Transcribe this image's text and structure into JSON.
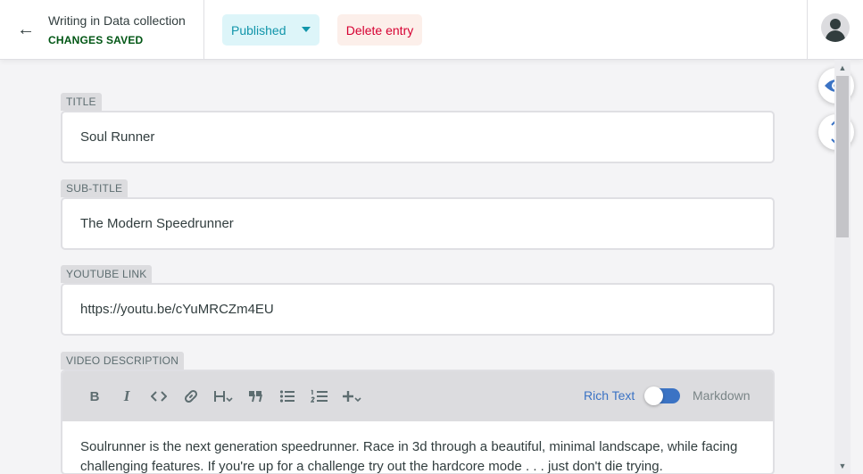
{
  "header": {
    "back_icon": "arrow-left-icon",
    "collection_label": "Writing in Data collection",
    "save_status": "CHANGES SAVED",
    "status_dropdown": {
      "selected": "Published"
    },
    "delete_label": "Delete entry",
    "avatar_icon": "user-avatar-icon"
  },
  "fields": {
    "title": {
      "label": "TITLE",
      "value": "Soul Runner"
    },
    "subtitle": {
      "label": "SUB-TITLE",
      "value": "The Modern Speedrunner"
    },
    "youtube": {
      "label": "YOUTUBE LINK",
      "value": "https://youtu.be/cYuMRCZm4EU"
    },
    "description": {
      "label": "VIDEO DESCRIPTION",
      "toolbar": [
        "bold-icon",
        "italic-icon",
        "code-icon",
        "link-icon",
        "heading-icon",
        "quote-icon",
        "bulleted-list-icon",
        "numbered-list-icon",
        "add-block-icon"
      ],
      "mode_richtext": "Rich Text",
      "mode_markdown": "Markdown",
      "value": "Soulrunner is the next generation speedrunner. Race in 3d through a beautiful, minimal landscape, while facing challenging features. If you're up for a challenge try out the hardcore mode . . . just don't die trying."
    }
  },
  "side_actions": [
    "preview-eye-icon",
    "scroll-sync-icon"
  ],
  "colors": {
    "accent": "#3b73c4",
    "status": "#1195aa",
    "status_bg": "#ddf5f9",
    "danger": "#d60032",
    "danger_bg": "#fcefea",
    "saved": "#005614"
  }
}
